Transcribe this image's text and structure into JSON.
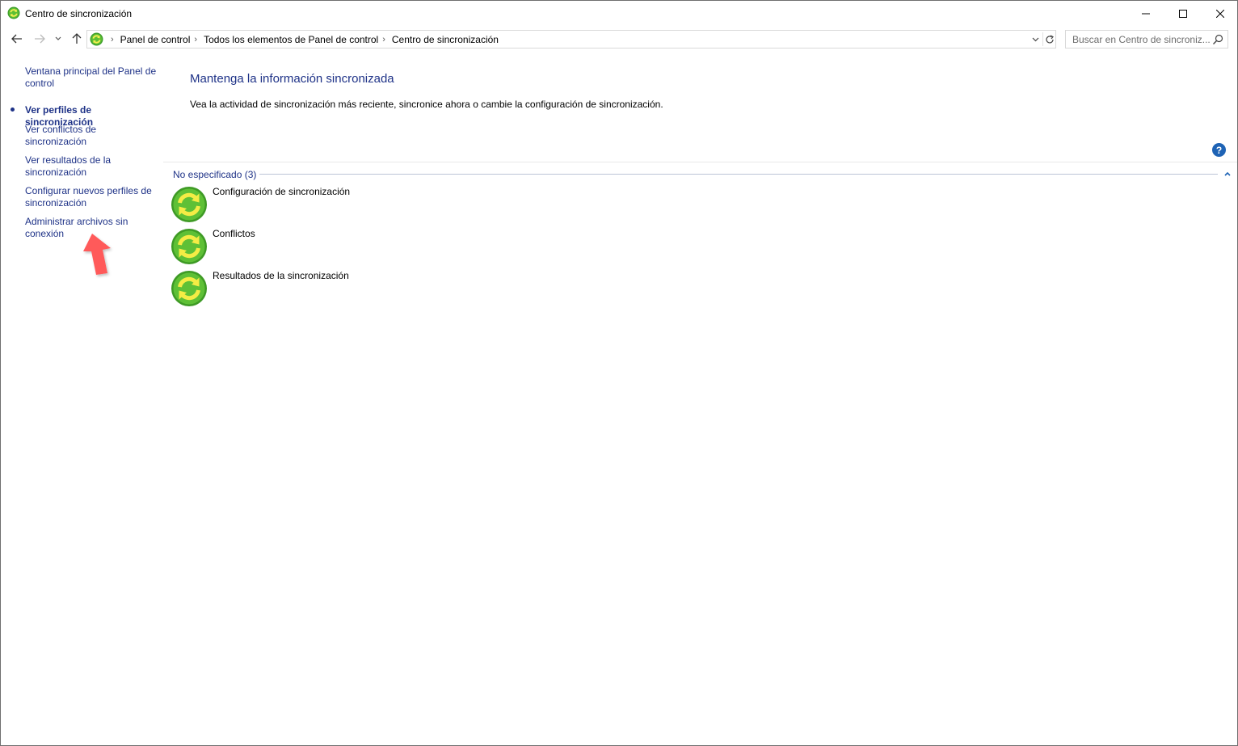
{
  "window": {
    "title": "Centro de sincronización",
    "icon": "sync-center-icon"
  },
  "nav": {
    "breadcrumbs": [
      "Panel de control",
      "Todos los elementos de Panel de control",
      "Centro de sincronización"
    ],
    "search_placeholder": "Buscar en Centro de sincroniz..."
  },
  "sidebar": {
    "links": [
      {
        "label": "Ventana principal del Panel de control",
        "current": false
      },
      {
        "label": "Ver perfiles de sincronización",
        "current": true
      },
      {
        "label": "Ver conflictos de sincronización",
        "current": false
      },
      {
        "label": "Ver resultados de la sincronización",
        "current": false
      },
      {
        "label": "Configurar nuevos perfiles de sincronización",
        "current": false
      },
      {
        "label": "Administrar archivos sin conexión",
        "current": false
      }
    ]
  },
  "main": {
    "title": "Mantenga la información sincronizada",
    "description": "Vea la actividad de sincronización más reciente, sincronice ahora o cambie la configuración de sincronización.",
    "help_label": "?",
    "group": {
      "header": "No especificado (3)",
      "items": [
        {
          "label": "Configuración de sincronización",
          "icon": "sync-icon"
        },
        {
          "label": "Conflictos",
          "icon": "sync-icon"
        },
        {
          "label": "Resultados de la sincronización",
          "icon": "sync-icon"
        }
      ]
    }
  },
  "colors": {
    "link": "#1e3287",
    "sync_green": "#4caf2a",
    "sync_arrows": "#f2e63a",
    "help_blue": "#1e63b5",
    "annotation_arrow": "#ff4f4f"
  }
}
